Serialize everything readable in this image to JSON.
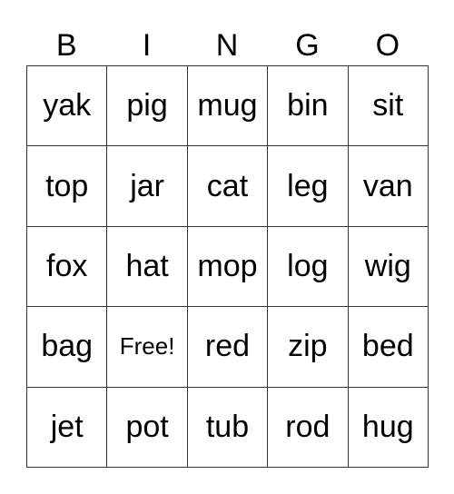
{
  "header": [
    "B",
    "I",
    "N",
    "G",
    "O"
  ],
  "grid": [
    [
      "yak",
      "pig",
      "mug",
      "bin",
      "sit"
    ],
    [
      "top",
      "jar",
      "cat",
      "leg",
      "van"
    ],
    [
      "fox",
      "hat",
      "mop",
      "log",
      "wig"
    ],
    [
      "bag",
      "Free!",
      "red",
      "zip",
      "bed"
    ],
    [
      "jet",
      "pot",
      "tub",
      "rod",
      "hug"
    ]
  ]
}
